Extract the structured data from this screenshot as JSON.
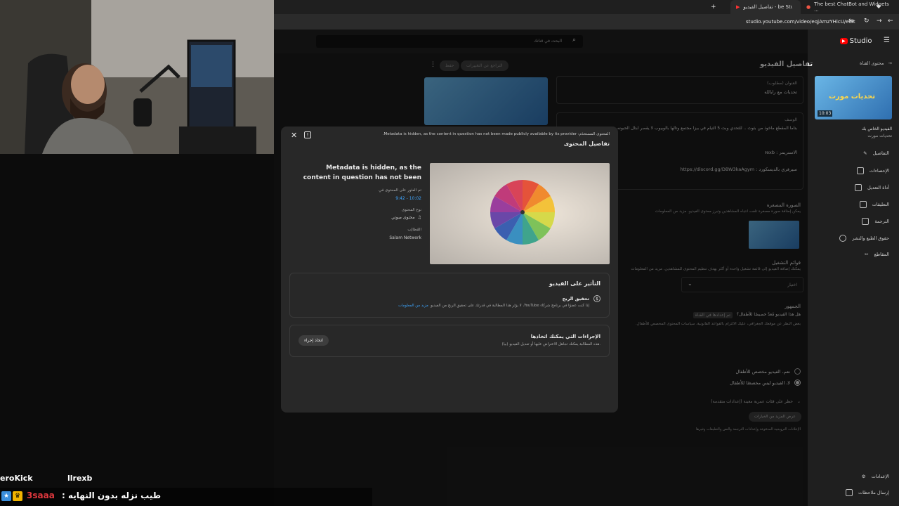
{
  "browser": {
    "tabs": [
      {
        "label": "The best ChatBot and Widgets ..."
      },
      {
        "label": "تفاصيل الفيديو - be Studio"
      }
    ],
    "url": "studio.youtube.com/video/eqjAmzYHicU/edit"
  },
  "studio": {
    "logo": "Studio",
    "search_placeholder": "البحث في قناتك",
    "page_title": "تفاصيل الفيديو",
    "back_label": "محتوى القناة",
    "channel_video_label": "الفيديو الخاص بك",
    "channel_video_sub": "تحديات مورت",
    "thumb_caption": "تحديات مورت",
    "thumb_duration": "10:03",
    "nav_items": [
      "التفاصيل",
      "الإحصاءات",
      "أداة التعديل",
      "التعليقات",
      "الترجمة",
      "حقوق الطبع والنشر",
      "المقاطع"
    ],
    "bottom_nav": [
      "الإعدادات",
      "إرسال ملاحظات"
    ],
    "title_box_label": "العنوان (مطلوب)",
    "title_box_value": "تحديات مع رابالله",
    "description_label": "الوصف",
    "description_text": "بتاما المقطع ماخوذ من بثوث .. للتحدي وبث 5 التيام في بيزا مجتمع وتالها بالوبيوب لا يقصر ابتال الحبونه مع ...",
    "streamer_label": "الاستريمر :",
    "streamer_name": "rexb",
    "discord_label": "سيرفري بالديسكورد :",
    "discord_link": "https://discord.gg/DBW3kaAgym",
    "thumbnail_section": "الصورة المصغرة",
    "thumbnail_desc": "يمكن إضافة صورة مصغرة تلفت انتباه المشاهدين وتبرز محتوى الفيديو. مزيد من المعلومات",
    "playlists_section": "قوائم التشغيل",
    "playlists_desc": "يمكنك إضافة الفيديو إلى قائمة تشغيل واحدة أو أكثر بهدف تنظيم المحتوى للمشاهدين. مزيد من المعلومات",
    "playlist_select": "اختيار",
    "audience_section": "الجمهور",
    "audience_q": "هل هذا الفيديو مُعدّ خصيصًا للأطفال؟",
    "audience_tag": "تم إعدادها في القناة",
    "audience_desc": "بغض النظر عن موقعك الجغرافي، عليك الالتزام بالقواعد القانونية. سياسات المحتوى المخصص للأطفال.",
    "radio_yes": "نعم، الفيديو مخصص للأطفال",
    "radio_no": "لا، الفيديو ليس مخصصًا للأطفال",
    "age_restriction": "حظر على فئات عمرية معينة (إعدادات متقدمة)",
    "show_more": "عرض المزيد من الخيارات",
    "show_more_desc": "الإعلانات الترويجية المدفوعة وإعدادات الترجمة والنص والتعليقات وغيرها",
    "top_buttons": [
      "التراجع عن التغييرات",
      "حفظ"
    ]
  },
  "modal": {
    "header_label": "المحتوى المستخدَم:",
    "header_notice": "Metadata is hidden, as the content in question has not been made publicly available by its provider.",
    "title": "تفاصيل المحتوى",
    "content_title": "Metadata is hidden, as the content in question has not been made publicly available by its provider",
    "found_label": "تم العثور على المحتوى في",
    "found_value": "9:42 - 10:02",
    "type_label": "نوع المحتوى",
    "type_value": "محتوى صوتي",
    "claimant_label": "المُطالِب",
    "claimant_value": "Salam Network",
    "impact_title": "التأثير على الفيديو",
    "impact_item_title": "تحقيق الربح",
    "impact_item_desc": "إذا كنت عضوًا في برنامج شركاء YouTube، لا يؤثر هذا المطالبة في قدرتك على تحقيق الربح من الفيديو.",
    "impact_link": "مزيد من المعلومات",
    "actions_title": "الإجراءات التي يمكنك اتخاذها",
    "actions_desc": "(بيا) هذه المطالبة يمكنك تجاهل الاعتراض عليها أو تعديل الفيديو.",
    "action_button": "اتخاذ إجراء"
  },
  "chat": {
    "user1": "eroKick",
    "user2": "llrexb",
    "line_name": "3saaa",
    "line_message": "طيب نزله بدون النهايه :"
  },
  "colors": {
    "accent_blue": "#3ea6ff",
    "youtube_red": "#ff0000",
    "chat_red": "#e0383e"
  }
}
